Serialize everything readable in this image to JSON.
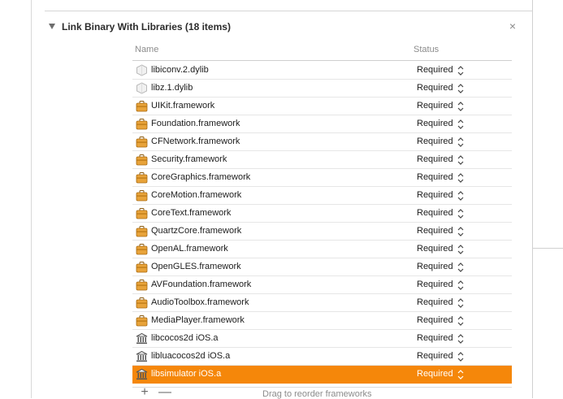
{
  "phase": {
    "title": "Link Binary With Libraries (18 items)",
    "close_glyph": "×"
  },
  "columns": {
    "name": "Name",
    "status": "Status"
  },
  "libraries": [
    {
      "name": "libiconv.2.dylib",
      "status": "Required",
      "icon": "dylib-icon"
    },
    {
      "name": "libz.1.dylib",
      "status": "Required",
      "icon": "dylib-icon"
    },
    {
      "name": "UIKit.framework",
      "status": "Required",
      "icon": "framework-icon"
    },
    {
      "name": "Foundation.framework",
      "status": "Required",
      "icon": "framework-icon"
    },
    {
      "name": "CFNetwork.framework",
      "status": "Required",
      "icon": "framework-icon"
    },
    {
      "name": "Security.framework",
      "status": "Required",
      "icon": "framework-icon"
    },
    {
      "name": "CoreGraphics.framework",
      "status": "Required",
      "icon": "framework-icon"
    },
    {
      "name": "CoreMotion.framework",
      "status": "Required",
      "icon": "framework-icon"
    },
    {
      "name": "CoreText.framework",
      "status": "Required",
      "icon": "framework-icon"
    },
    {
      "name": "QuartzCore.framework",
      "status": "Required",
      "icon": "framework-icon"
    },
    {
      "name": "OpenAL.framework",
      "status": "Required",
      "icon": "framework-icon"
    },
    {
      "name": "OpenGLES.framework",
      "status": "Required",
      "icon": "framework-icon"
    },
    {
      "name": "AVFoundation.framework",
      "status": "Required",
      "icon": "framework-icon"
    },
    {
      "name": "AudioToolbox.framework",
      "status": "Required",
      "icon": "framework-icon"
    },
    {
      "name": "MediaPlayer.framework",
      "status": "Required",
      "icon": "framework-icon"
    },
    {
      "name": "libcocos2d iOS.a",
      "status": "Required",
      "icon": "static-library-icon"
    },
    {
      "name": "libluacocos2d iOS.a",
      "status": "Required",
      "icon": "static-library-icon"
    },
    {
      "name": "libsimulator iOS.a",
      "status": "Required",
      "icon": "static-library-icon",
      "selected": true
    }
  ],
  "footer": {
    "add_glyph": "+",
    "remove_glyph": "—",
    "hint": "Drag to reorder frameworks"
  },
  "colors": {
    "selection": "#f5870a",
    "framework_icon": "#e8a33a"
  }
}
